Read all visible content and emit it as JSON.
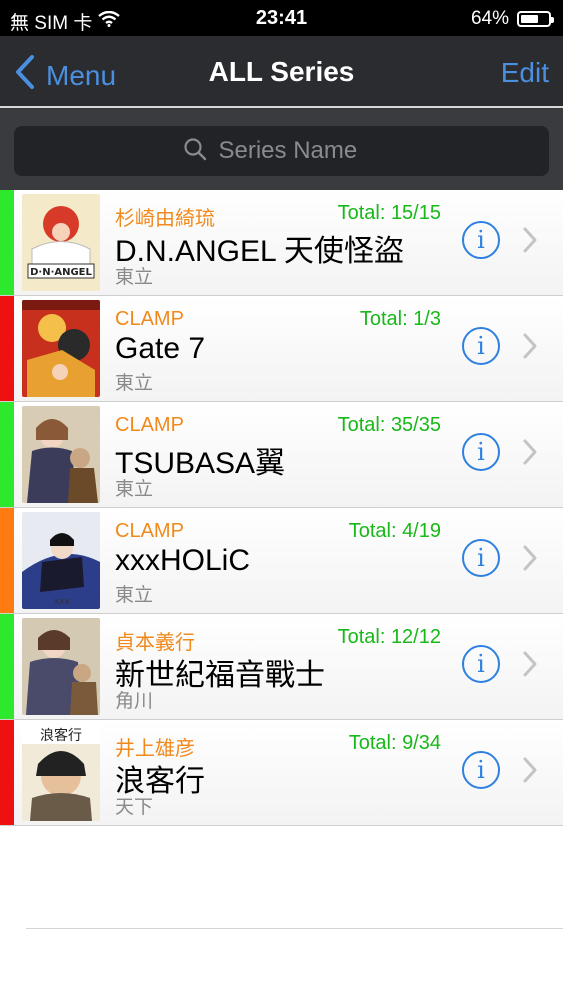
{
  "status_bar": {
    "carrier": "無 SIM 卡",
    "time": "23:41",
    "battery_percent": "64%",
    "battery_level": 0.64
  },
  "nav": {
    "back_label": "Menu",
    "title": "ALL Series",
    "edit_label": "Edit"
  },
  "search": {
    "placeholder": "Series Name",
    "value": ""
  },
  "colors": {
    "accent_blue": "#4a8fe0",
    "author_orange": "#f08a1c",
    "total_green": "#19b819",
    "status_green": "#2ee82e",
    "status_red": "#ee1111",
    "status_orange": "#ff7a10"
  },
  "series": [
    {
      "author": "杉崎由綺琉",
      "total": "Total: 15/15",
      "name": "D.N.ANGEL 天使怪盜",
      "publisher": "東立",
      "status_color": "#2ee82e",
      "cover_icon": "cover-dn-angel"
    },
    {
      "author": "CLAMP",
      "total": "Total: 1/3",
      "name": "Gate 7",
      "publisher": "東立",
      "status_color": "#ee1111",
      "cover_icon": "cover-gate-7"
    },
    {
      "author": "CLAMP",
      "total": "Total: 35/35",
      "name": "TSUBASA翼",
      "publisher": "東立",
      "status_color": "#2ee82e",
      "cover_icon": "cover-tsubasa"
    },
    {
      "author": "CLAMP",
      "total": "Total: 4/19",
      "name": "xxxHOLiC",
      "publisher": "東立",
      "status_color": "#ff7a10",
      "cover_icon": "cover-xxxholic"
    },
    {
      "author": "貞本義行",
      "total": "Total: 12/12",
      "name": "新世紀福音戰士",
      "publisher": "角川",
      "status_color": "#2ee82e",
      "cover_icon": "cover-eva"
    },
    {
      "author": "井上雄彦",
      "total": "Total: 9/34",
      "name": "浪客行",
      "publisher": "天下",
      "status_color": "#ee1111",
      "cover_icon": "cover-vagabond"
    }
  ]
}
